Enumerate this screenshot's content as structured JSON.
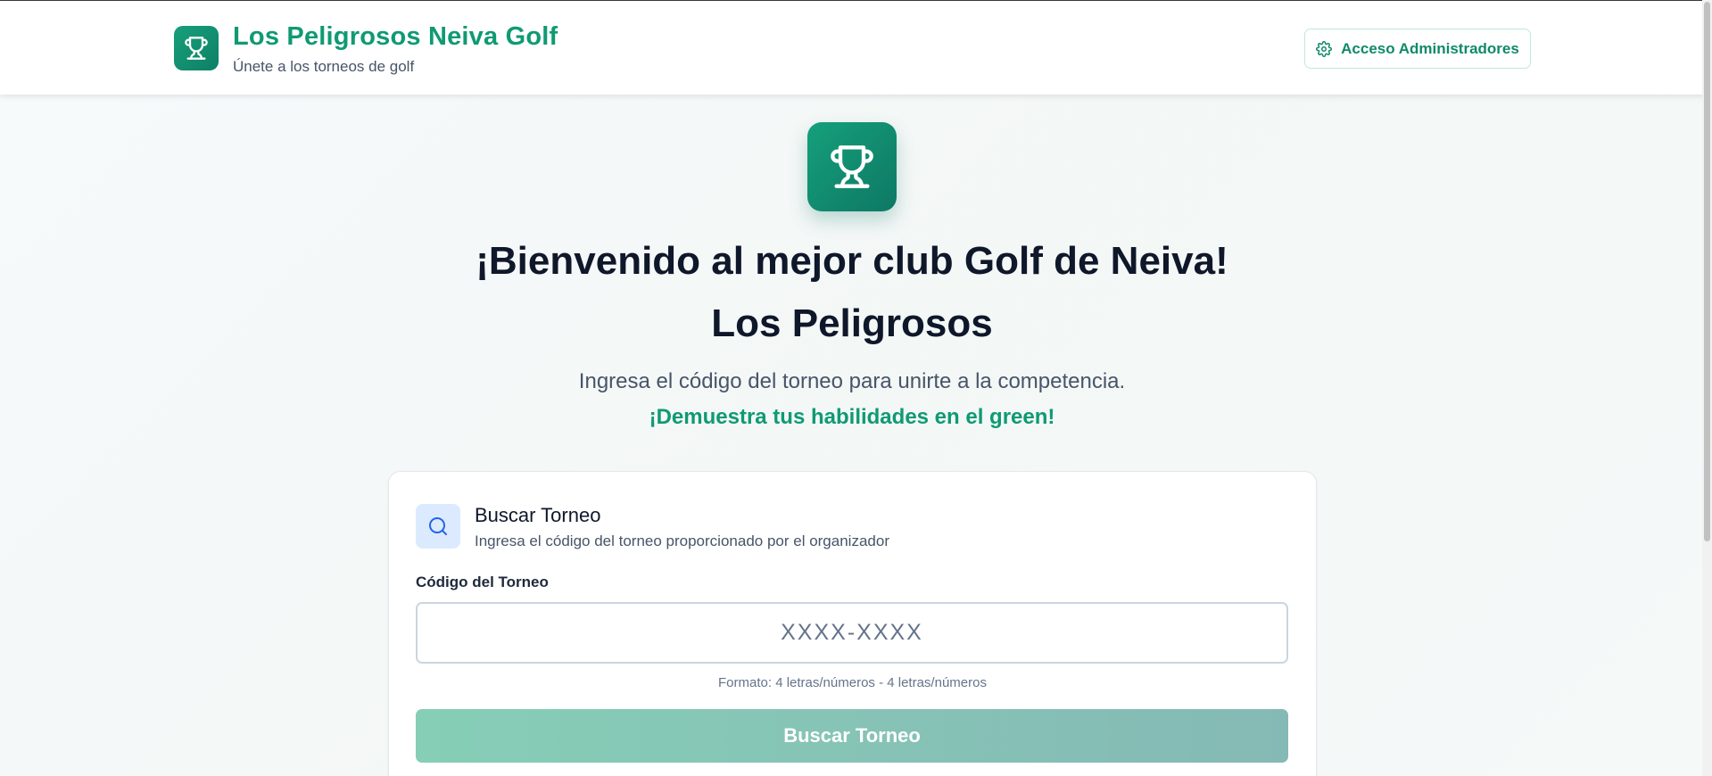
{
  "header": {
    "brand_title": "Los Peligrosos Neiva Golf",
    "brand_subtitle": "Únete a los torneos de golf",
    "admin_button_label": "Acceso Administradores",
    "logo_icon": "trophy-icon",
    "admin_icon": "gear-icon"
  },
  "hero": {
    "icon": "trophy-icon",
    "title_line1": "¡Bienvenido al mejor club Golf de Neiva!",
    "title_line2": "Los Peligrosos",
    "description": "Ingresa el código del torneo para unirte a la competencia.",
    "tagline": "¡Demuestra tus habilidades en el green!"
  },
  "search_card": {
    "icon": "search-icon",
    "title": "Buscar Torneo",
    "subtitle": "Ingresa el código del torneo proporcionado por el organizador",
    "field_label": "Código del Torneo",
    "input_placeholder": "XXXX-XXXX",
    "input_value": "",
    "format_hint": "Formato: 4 letras/números - 4 letras/números",
    "submit_label": "Buscar Torneo"
  },
  "colors": {
    "brand_green": "#0f9a73",
    "dark_text": "#0f172a",
    "muted_text": "#475569",
    "search_badge_bg": "#dbeafe",
    "button_disabled_start": "#86ceb6",
    "button_disabled_end": "#85b9b5"
  }
}
